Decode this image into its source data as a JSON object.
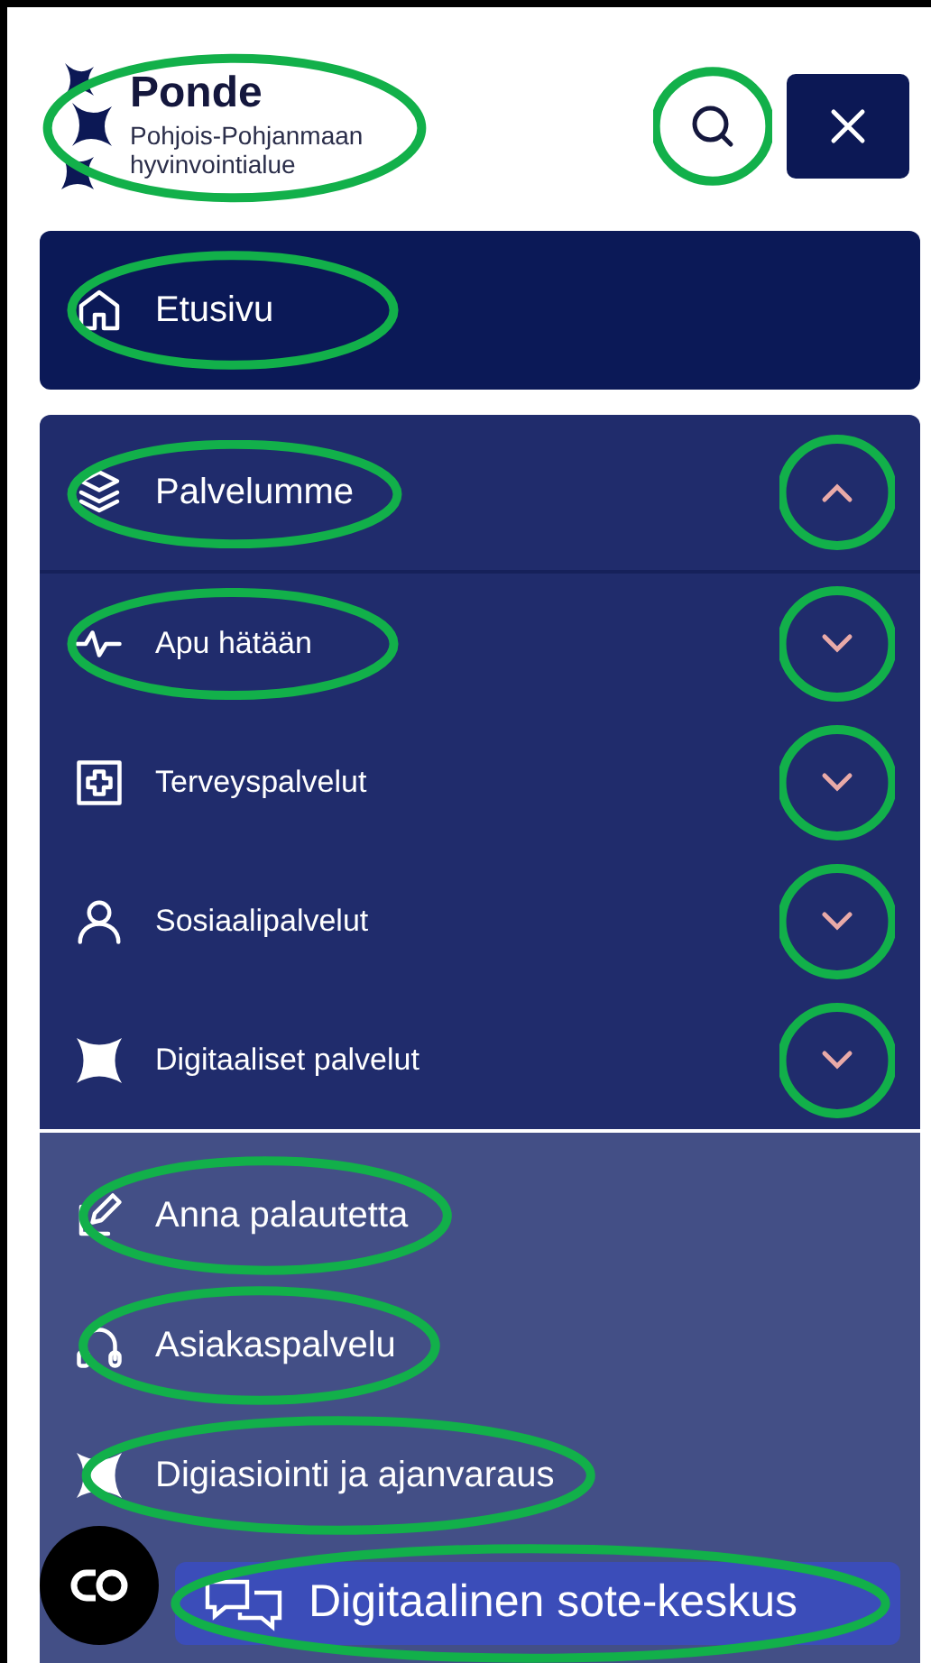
{
  "logo": {
    "name": "Ponde",
    "subtitle": "Pohjois-Pohjanmaan hyvinvointialue",
    "highlighted": true
  },
  "search_button": {
    "highlighted": true
  },
  "primary_nav": [
    {
      "label": "Etusivu",
      "kind": "home",
      "highlighted": true
    }
  ],
  "services": {
    "label": "Palvelumme",
    "kind": "layers",
    "expanded": true,
    "label_highlighted": true,
    "toggle_highlighted": true,
    "children": [
      {
        "label": "Apu hätään",
        "kind": "pulse",
        "expanded": false,
        "label_highlighted": true,
        "toggle_highlighted": true
      },
      {
        "label": "Terveyspalvelut",
        "kind": "cross",
        "expanded": false,
        "label_highlighted": false,
        "toggle_highlighted": true
      },
      {
        "label": "Sosiaalipalvelut",
        "kind": "person",
        "expanded": false,
        "label_highlighted": false,
        "toggle_highlighted": true
      },
      {
        "label": "Digitaaliset palvelut",
        "kind": "star",
        "expanded": false,
        "label_highlighted": false,
        "toggle_highlighted": true
      }
    ]
  },
  "secondary_nav": [
    {
      "label": "Anna palautetta",
      "kind": "edit",
      "highlighted": true
    },
    {
      "label": "Asiakaspalvelu",
      "kind": "headset",
      "highlighted": true
    },
    {
      "label": "Digiasiointi ja ajanvaraus",
      "kind": "star",
      "highlighted": true
    }
  ],
  "chat_button": {
    "label": "Digitaalinen sote-keskus",
    "highlighted": true
  }
}
